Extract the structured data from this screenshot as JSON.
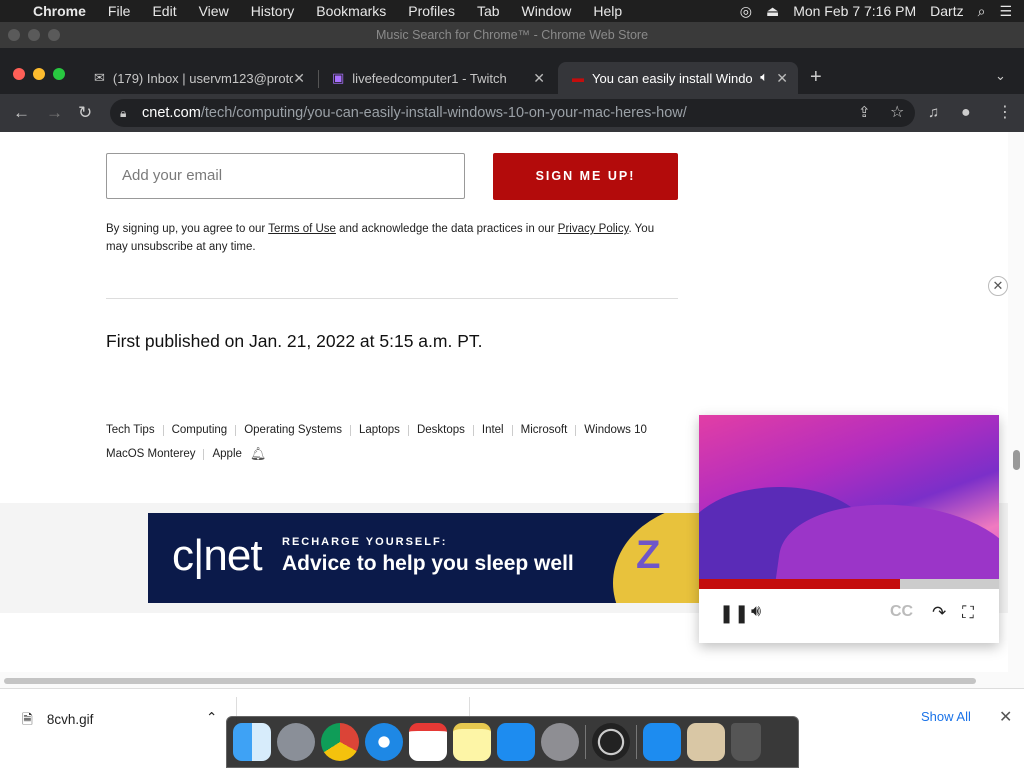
{
  "menubar": {
    "items": [
      "Chrome",
      "File",
      "Edit",
      "View",
      "History",
      "Bookmarks",
      "Profiles",
      "Tab",
      "Window",
      "Help"
    ],
    "datetime": "Mon Feb 7  7:16 PM",
    "user": "Dartz"
  },
  "window": {
    "title": "Music Search for Chrome™ - Chrome Web Store"
  },
  "tabs": [
    {
      "title": "(179) Inbox | uservm123@proto",
      "icon": "mail-icon"
    },
    {
      "title": "livefeedcomputer1 - Twitch",
      "icon": "twitch-icon"
    },
    {
      "title": "You can easily install Windo",
      "icon": "cnet-icon",
      "active": true
    }
  ],
  "omnibox": {
    "host": "cnet.com",
    "path": "/tech/computing/you-can-easily-install-windows-10-on-your-mac-heres-how/"
  },
  "newsletter": {
    "email_placeholder": "Add your email",
    "signup_label": "SIGN ME UP!",
    "terms_prefix": "By signing up, you agree to our ",
    "terms_link": "Terms of Use",
    "terms_mid": " and acknowledge the data practices in our ",
    "privacy_link": "Privacy Policy",
    "terms_suffix": ". You may unsubscribe at any time."
  },
  "article": {
    "published": "First published on Jan. 21, 2022 at 5:15 a.m. PT.",
    "tags_row1": [
      "Tech Tips",
      "Computing",
      "Operating Systems",
      "Laptops",
      "Desktops",
      "Intel",
      "Microsoft",
      "Windows 10"
    ],
    "tags_row2": [
      "MacOS Monterey",
      "Apple"
    ]
  },
  "promo": {
    "logo": "c|net",
    "kicker": "RECHARGE YOURSELF:",
    "headline": "Advice to help you sleep well",
    "z": "Z"
  },
  "video": {
    "progress": 0.67,
    "cc_label": "CC"
  },
  "downloads": {
    "file": "8cvh.gif",
    "show_all": "Show All"
  },
  "colors": {
    "accent_red": "#b30b0b",
    "link_blue": "#1a73e8"
  }
}
